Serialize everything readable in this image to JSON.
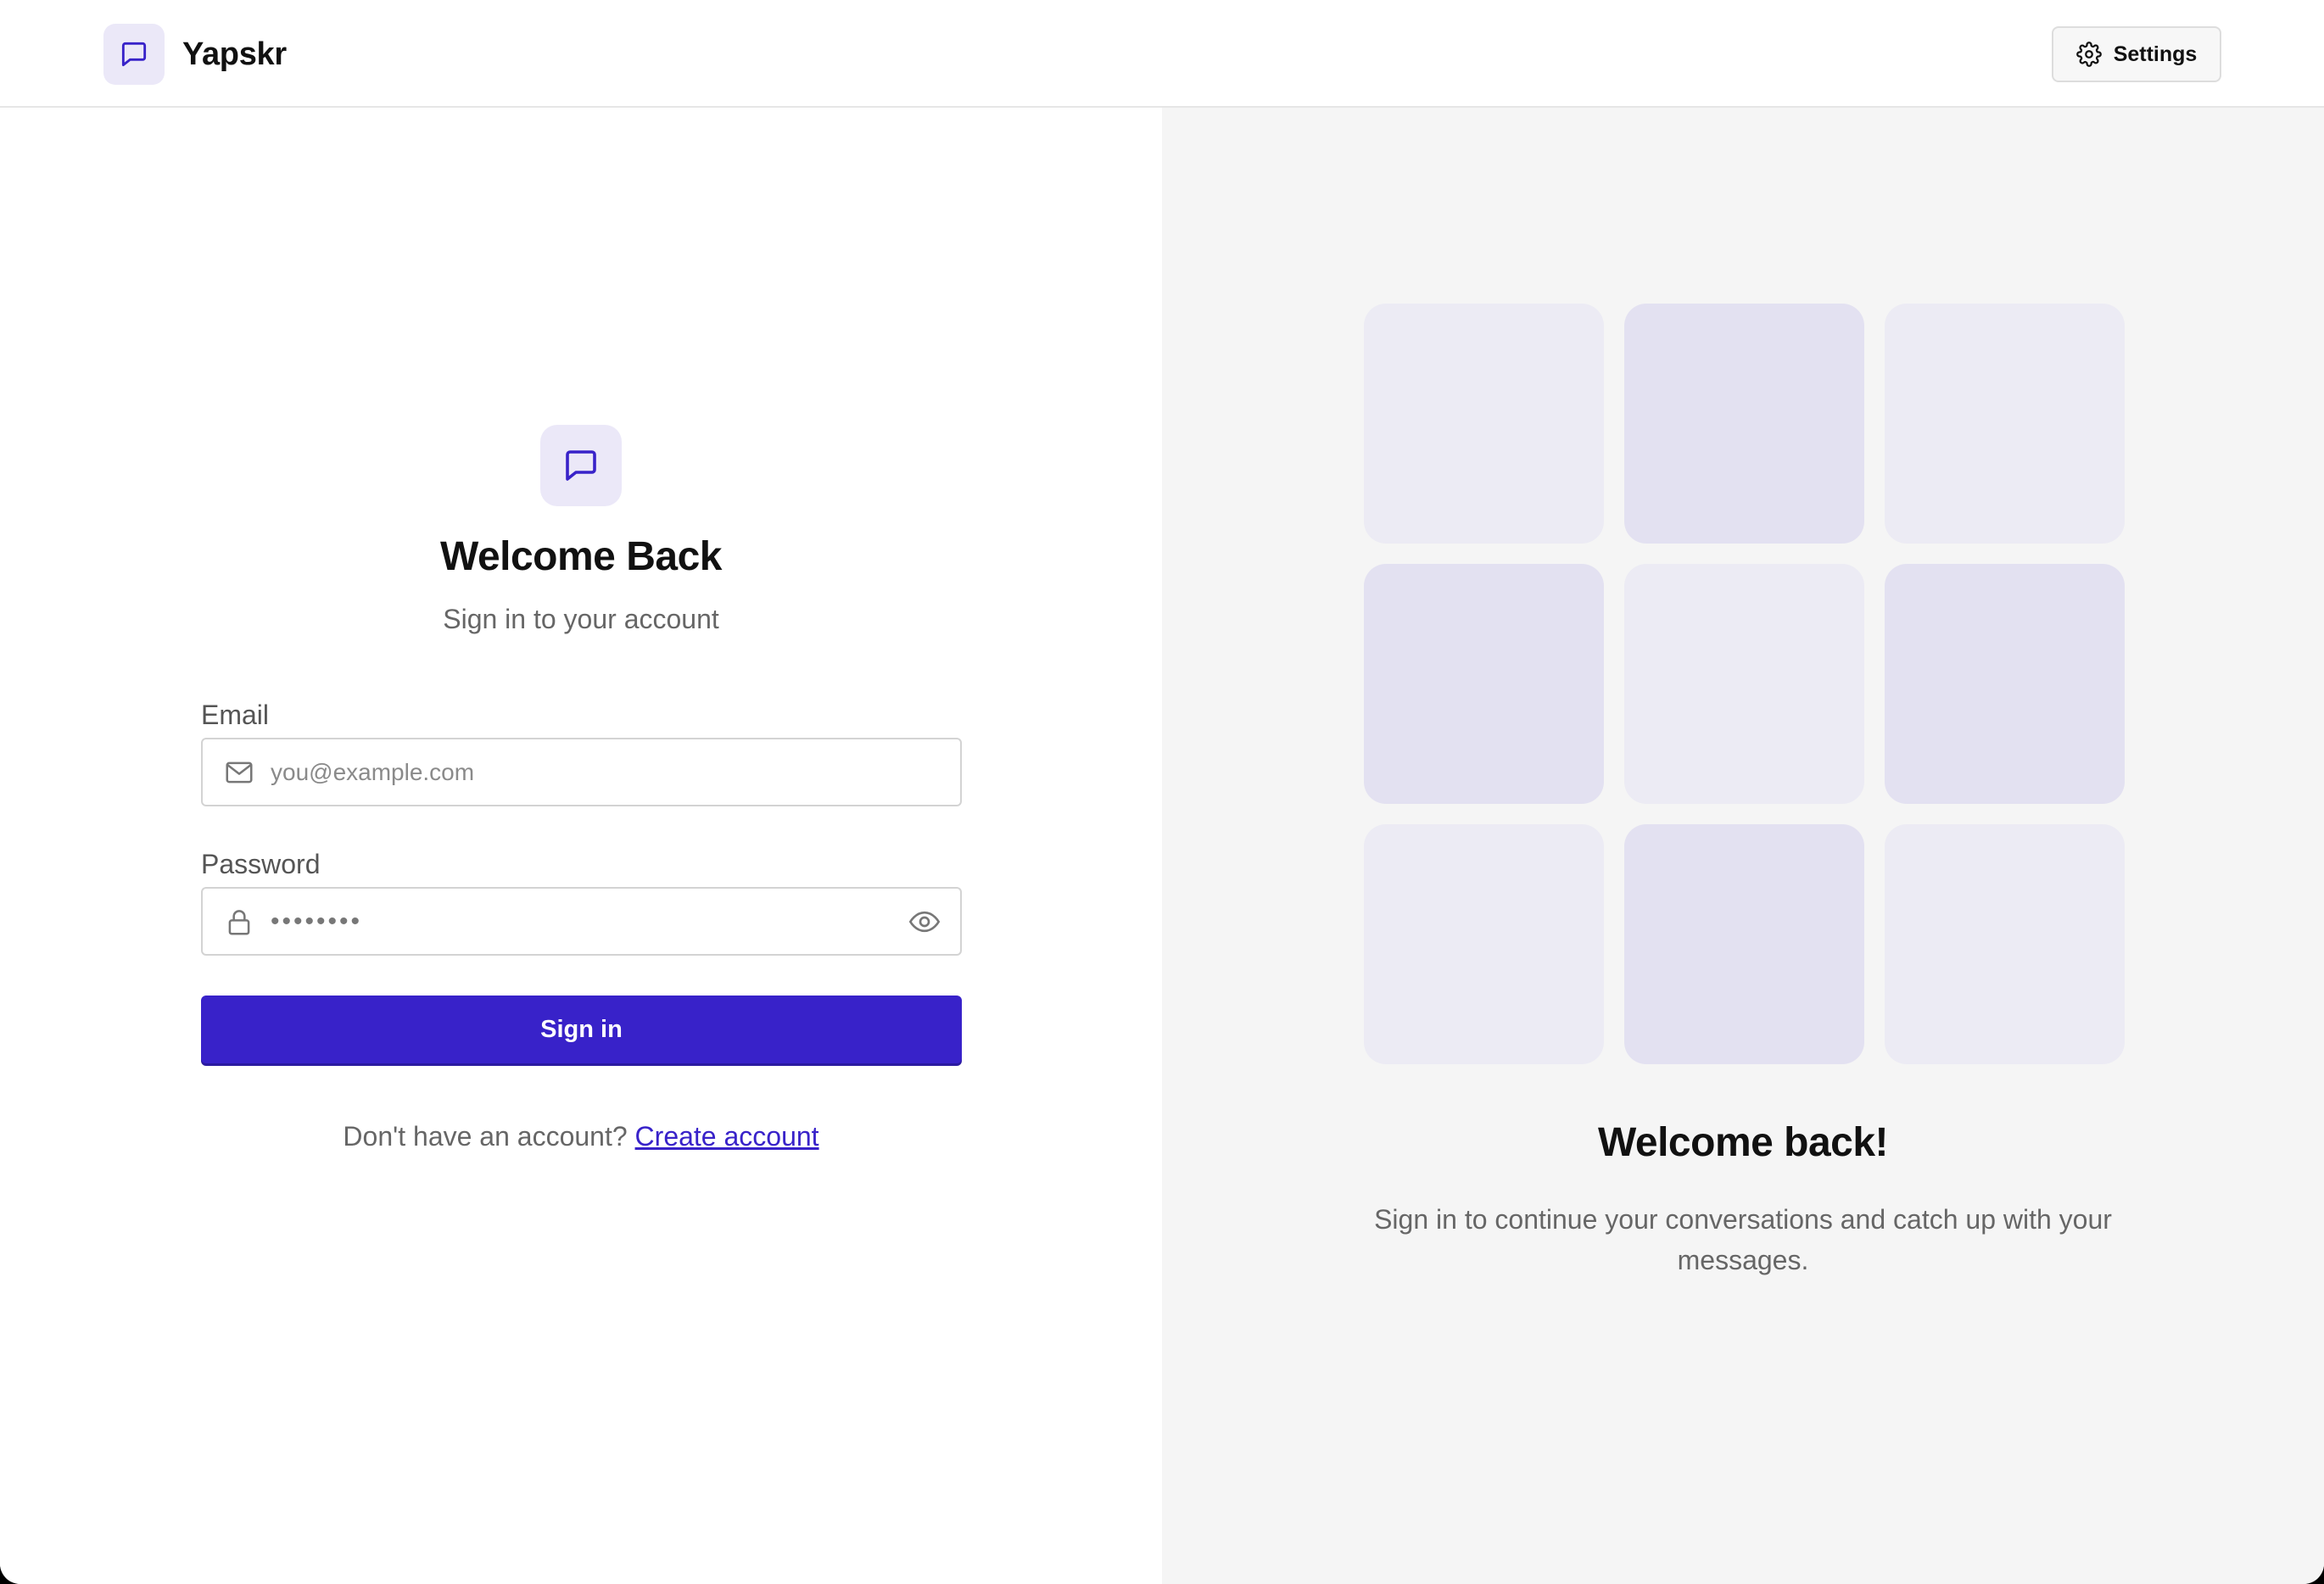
{
  "app": {
    "name": "Yapskr"
  },
  "header": {
    "settings_label": "Settings"
  },
  "login": {
    "title": "Welcome Back",
    "subtitle": "Sign in to your account",
    "email": {
      "label": "Email",
      "placeholder": "you@example.com"
    },
    "password": {
      "label": "Password",
      "value": "••••••••"
    },
    "submit_label": "Sign in",
    "signup_prompt": "Don't have an account?",
    "signup_link": "Create account"
  },
  "promo": {
    "title": "Welcome back!",
    "text": "Sign in to continue your conversations and catch up with your messages.",
    "tiles": [
      "light",
      "dark",
      "light",
      "dark",
      "light",
      "dark",
      "light",
      "dark",
      "light"
    ]
  },
  "colors": {
    "accent": "#3822c9",
    "icon_bg": "#ebe8f8",
    "tile_light": "#ecebf4",
    "tile_dark": "#e3e1f1",
    "panel_bg": "#f5f5f5"
  }
}
